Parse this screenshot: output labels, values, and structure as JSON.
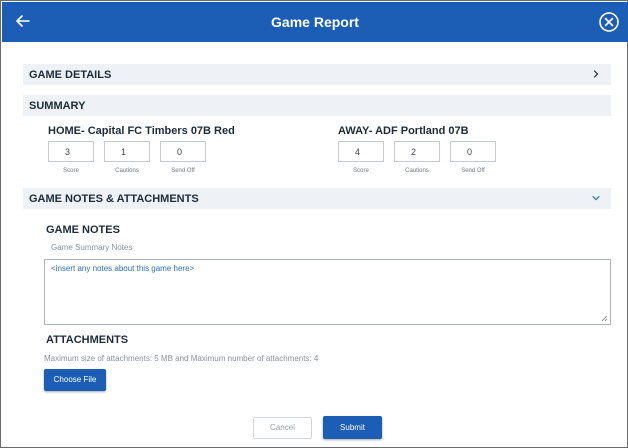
{
  "header": {
    "title": "Game Report",
    "back_icon": "arrow-left-icon",
    "close_icon": "close-circle-icon",
    "color": "#1c5eb5"
  },
  "game_details": {
    "label": "GAME DETAILS",
    "icon": "chevron-right-icon"
  },
  "summary": {
    "label": "SUMMARY",
    "home": {
      "title": "HOME- Capital FC Timbers 07B Red",
      "score": "3",
      "cautions": "1",
      "send_off": "0"
    },
    "away": {
      "title": "AWAY- ADF Portland 07B",
      "score": "4",
      "cautions": "2",
      "send_off": "0"
    },
    "captions": {
      "score": "Score",
      "cautions": "Cautions",
      "send_off": "Send Off"
    }
  },
  "notes_attachments": {
    "label": "GAME NOTES & ATTACHMENTS",
    "icon": "chevron-down-icon",
    "notes_title": "GAME NOTES",
    "notes_label": "Game Summary Notes",
    "notes_value": "<insert any notes about this game here>",
    "attachments_title": "ATTACHMENTS",
    "attachments_hint": "Maximum size of attachments: 5 MB and Maximum number of attachments: 4",
    "choose_file_label": "Choose File"
  },
  "footer": {
    "cancel_label": "Cancel",
    "submit_label": "Submit"
  }
}
